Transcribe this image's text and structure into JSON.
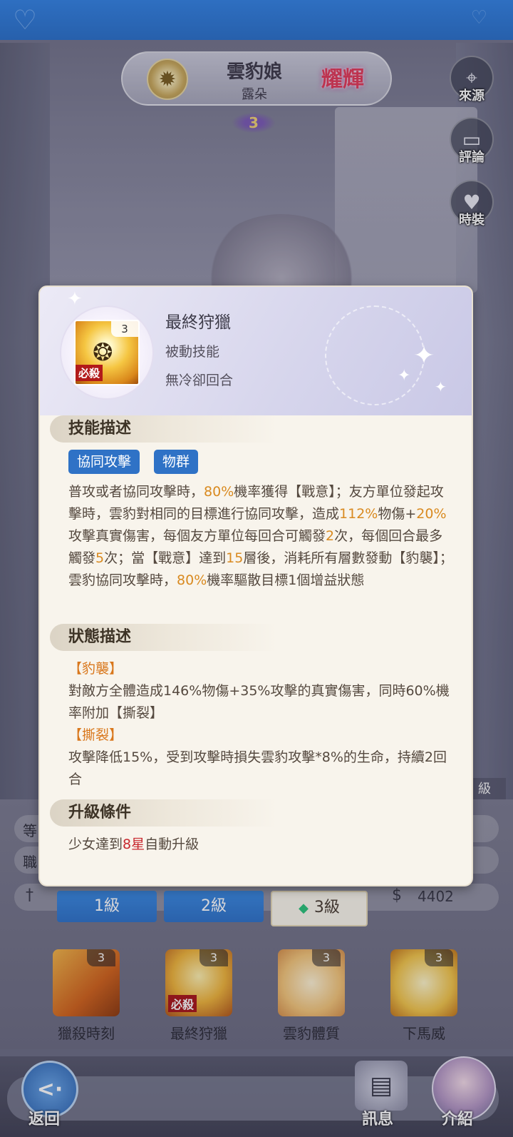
{
  "character": {
    "name": "雲豹娘",
    "subname": "露朵",
    "rank_badge": "耀輝",
    "star_level": "3"
  },
  "side_buttons": {
    "source": "來源",
    "comments": "評論",
    "outfit": "時裝"
  },
  "popup": {
    "skill_icon_level": "3",
    "skill_icon_badge": "必殺",
    "skill_name": "最終狩獵",
    "skill_type": "被動技能",
    "cooldown": "無冷卻回合",
    "sections": {
      "description_title": "技能描述",
      "status_title": "狀態描述",
      "upgrade_title": "升級條件"
    },
    "tags": [
      "協同攻擊",
      "物群"
    ],
    "description": {
      "p1": "普攻或者協同攻擊時，",
      "h1": "80%",
      "p2": "機率獲得【戰意】；友方單位發起攻擊時，雲豹對相同的目標進行協同攻擊，造成",
      "h2": "112%",
      "p3": "物傷+",
      "h3": "20%",
      "p4": "攻擊真實傷害，每個友方單位每回合可觸發",
      "h4": "2",
      "p5": "次，每個回合最多觸發",
      "h5": "5",
      "p6": "次；當【戰意】達到",
      "h6": "15",
      "p7": "層後，消耗所有層數發動【豹襲】；雲豹協同攻擊時，",
      "h7": "80%",
      "p8": "機率驅散目標1個增益狀態"
    },
    "status": {
      "s1_title": "【豹襲】",
      "s1_text": "對敵方全體造成146%物傷+35%攻擊的真實傷害，同時60%機率附加【撕裂】",
      "s2_title": "【撕裂】",
      "s2_text": "攻擊降低15%，受到攻擊時損失雲豹攻擊*8%的生命，持續2回合"
    },
    "upgrade": {
      "u1": "少女達到",
      "u2": "8星",
      "u3": "自動升級"
    }
  },
  "under_panel": {
    "row1_label": "等",
    "row2_label": "職",
    "level_tag": "級",
    "power_value": "4402",
    "level_tabs": [
      "1級",
      "2級",
      "3級"
    ],
    "skills": [
      {
        "name": "獵殺時刻",
        "level": "3"
      },
      {
        "name": "最終狩獵",
        "level": "3",
        "badge": "必殺"
      },
      {
        "name": "雲豹體質",
        "level": "3"
      },
      {
        "name": "下馬威",
        "level": "3"
      }
    ]
  },
  "bottom_nav": {
    "back": "返回",
    "message": "訊息",
    "intro": "介紹"
  },
  "colors": {
    "accent_blue": "#2f72c6",
    "highlight_orange": "#d98a20",
    "highlight_red": "#c8282e"
  }
}
